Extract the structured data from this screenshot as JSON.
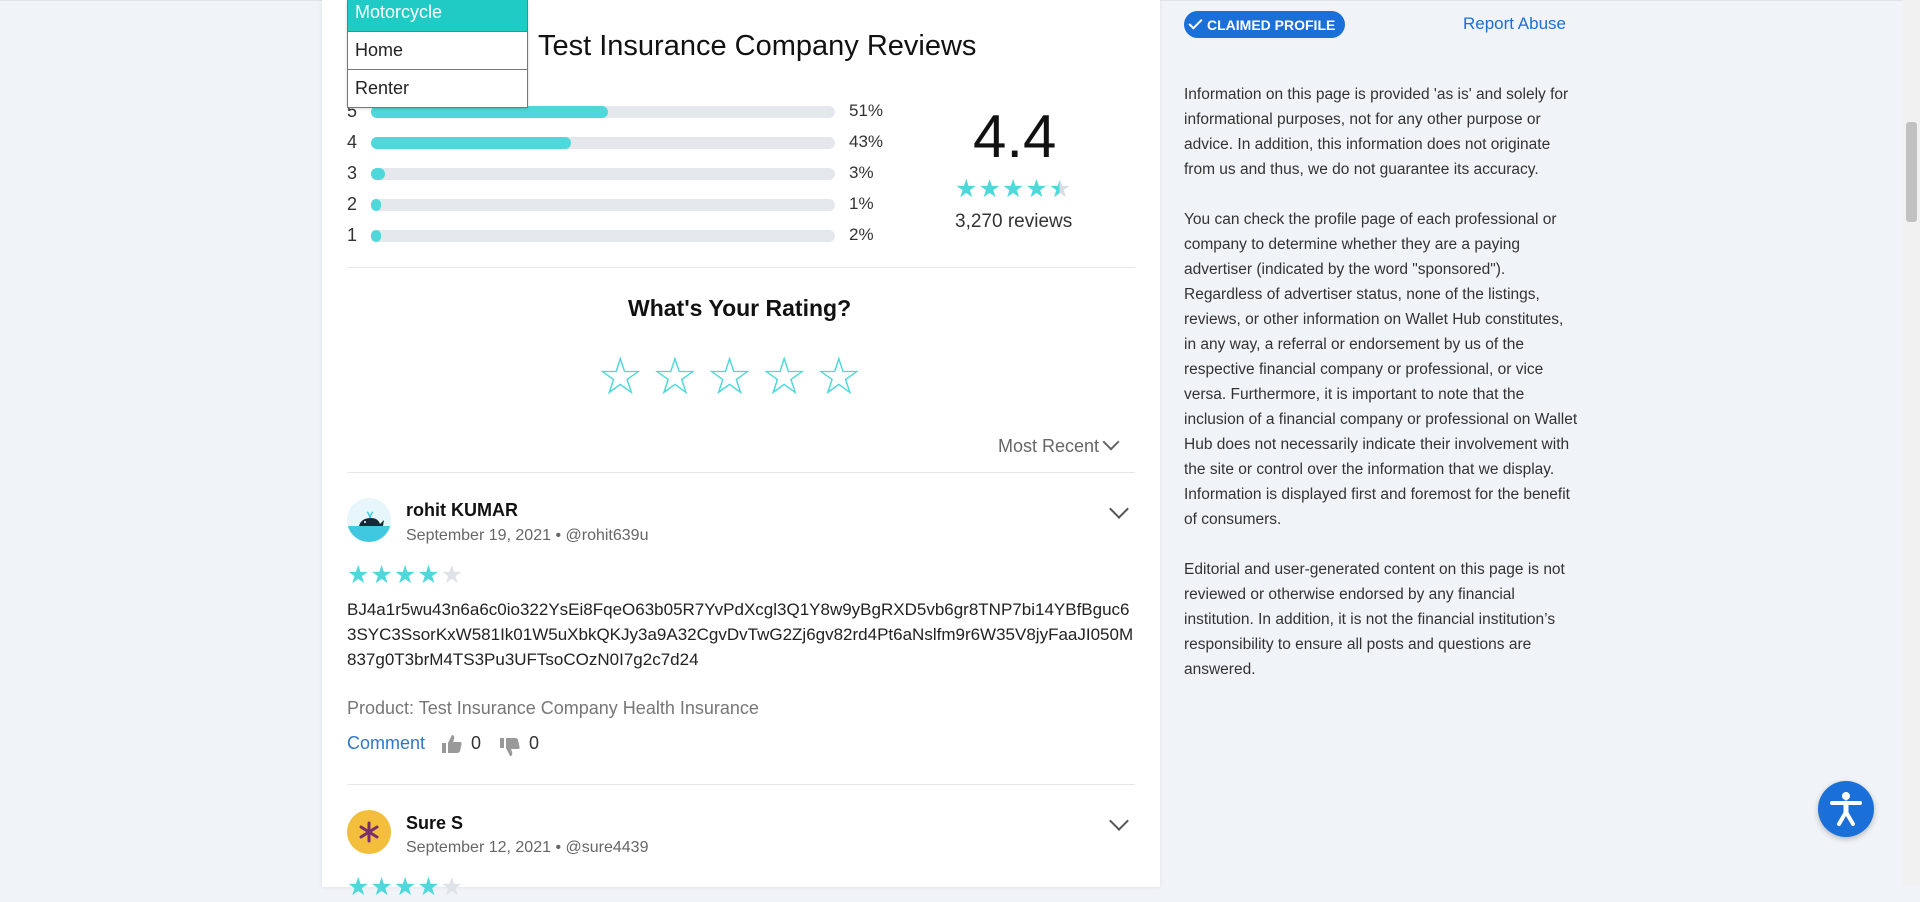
{
  "reviews_section": {
    "title": "Test Insurance Company Reviews",
    "distribution": [
      {
        "star": "5",
        "percent": 51,
        "label": "51%"
      },
      {
        "star": "4",
        "percent": 43,
        "label": "43%"
      },
      {
        "star": "3",
        "percent": 3,
        "label": "3%"
      },
      {
        "star": "2",
        "percent": 1,
        "label": "1%"
      },
      {
        "star": "1",
        "percent": 2,
        "label": "2%"
      }
    ],
    "average": "4.4",
    "average_stars": 4.4,
    "review_count": "3,270 reviews",
    "your_rating_title": "What's Your Rating?",
    "sort_label": "Most Recent"
  },
  "dropdown": {
    "items": [
      "Motorcycle",
      "Home",
      "Renter"
    ],
    "active": "Motorcycle"
  },
  "reviews": [
    {
      "name": "rohit KUMAR",
      "date": "September 19, 2021",
      "handle": "@rohit639u",
      "stars": 4,
      "text": "BJ4a1r5wu43n6a6c0io322YsEi8FqeO63b05R7YvPdXcgl3Q1Y8w9yBgRXD5vb6gr8TNP7bi14YBfBguc63SYC3SsorKxW581Ik01W5uXbkQKJy3a9A32CgvDvTwG2Zj6gv82rd4Pt6aNslfm9r6W35V8jyFaaJI050M837g0T3brM4TS3Pu3UFTsoCOzN0I7g2c7d24",
      "product": "Product: Test Insurance Company Health Insurance",
      "comment_label": "Comment",
      "likes": "0",
      "dislikes": "0"
    },
    {
      "name": "Sure S",
      "date": "September 12, 2021",
      "handle": "@sure4439",
      "stars": 4
    }
  ],
  "sidebar": {
    "claimed_label": "CLAIMED PROFILE",
    "report_label": "Report Abuse",
    "paragraphs": [
      "Information on this page is provided 'as is' and solely for informational purposes, not for any other purpose or advice. In addition, this information does not originate from us and thus, we do not guarantee its accuracy.",
      "You can check the profile page of each professional or company to determine whether they are a paying advertiser (indicated by the word \"sponsored\"). Regardless of advertiser status, none of the listings, reviews, or other information on Wallet Hub constitutes, in any way, a referral or endorsement by us of the respective financial company or professional, or vice versa. Furthermore, it is important to note that the inclusion of a financial company or professional on Wallet Hub does not necessarily indicate their involvement with the site or control over the information that we display. Information is displayed first and foremost for the benefit of consumers.",
      "Editorial and user-generated content on this page is not reviewed or otherwise endorsed by any financial institution. In addition, it is not the financial institution’s responsibility to ensure all posts and questions are answered."
    ]
  },
  "colors": {
    "accent": "#4ed8d9",
    "brand_blue": "#1b6fd8",
    "dropdown_active": "#1fcbc4"
  },
  "icons": [
    "check-icon",
    "chevron-down-icon",
    "thumbs-up-icon",
    "thumbs-down-icon",
    "star-icon",
    "accessibility-icon",
    "whale-avatar",
    "flower-avatar"
  ]
}
